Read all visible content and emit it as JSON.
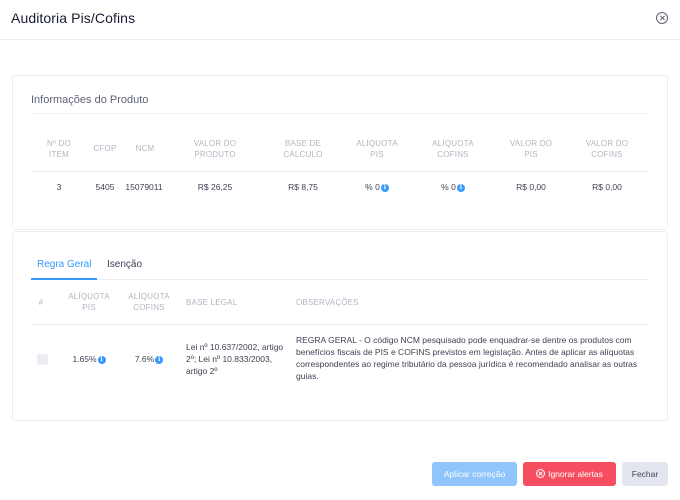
{
  "modal": {
    "title": "Auditoria Pis/Cofins"
  },
  "product_info": {
    "title": "Informações do Produto",
    "columns": [
      {
        "line1": "Nº DO",
        "line2": "ITEM"
      },
      {
        "line1": "CFOP",
        "line2": ""
      },
      {
        "line1": "NCM",
        "line2": ""
      },
      {
        "line1": "VALOR DO",
        "line2": "PRODUTO"
      },
      {
        "line1": "BASE DE",
        "line2": "CÁLCULO"
      },
      {
        "line1": "ALÍQUOTA",
        "line2": "PIS"
      },
      {
        "line1": "ALÍQUOTA",
        "line2": "COFINS"
      },
      {
        "line1": "VALOR DO",
        "line2": "PIS"
      },
      {
        "line1": "VALOR DO",
        "line2": "COFINS"
      }
    ],
    "row": {
      "item": "3",
      "cfop": "5405",
      "ncm": "15079011",
      "valor_produto": "R$ 26,25",
      "base_calculo": "R$ 8,75",
      "aliquota_pis": "% 0",
      "aliquota_cofins": "% 0",
      "valor_pis": "R$ 0,00",
      "valor_cofins": "R$ 0,00"
    }
  },
  "rules": {
    "tabs": [
      {
        "label": "Regra Geral",
        "active": true
      },
      {
        "label": "Isenção",
        "active": false
      }
    ],
    "columns": {
      "hash": "#",
      "aliq_pis_1": "ALÍQUOTA",
      "aliq_pis_2": "PIS",
      "aliq_cofins_1": "ALÍQUOTA",
      "aliq_cofins_2": "COFINS",
      "base_legal": "BASE LEGAL",
      "observacoes": "OBSERVAÇÕES"
    },
    "row": {
      "aliquota_pis": "1.65%",
      "aliquota_cofins": "7.6%",
      "base_legal": "Lei nº 10.637/2002, artigo 2º; Lei nº 10.833/2003, artigo 2º",
      "observacoes": "REGRA GERAL - O código NCM pesquisado pode enquadrar-se dentre os produtos com benefícios fiscais de PIS e COFINS previstos em legislação. Antes de aplicar as alíquotas correspondentes ao regime tributário da pessoa jurídica é recomendado analisar as outras guias."
    }
  },
  "footer": {
    "apply_label": "Aplicar correção",
    "ignore_label": "Ignorar alertas",
    "close_label": "Fechar"
  },
  "icons": {
    "info": "info-icon",
    "close": "close-icon",
    "ignore": "x-circle-icon"
  },
  "colors": {
    "primary": "#3699ff",
    "danger": "#f64e60",
    "light": "#e4e6ef"
  }
}
